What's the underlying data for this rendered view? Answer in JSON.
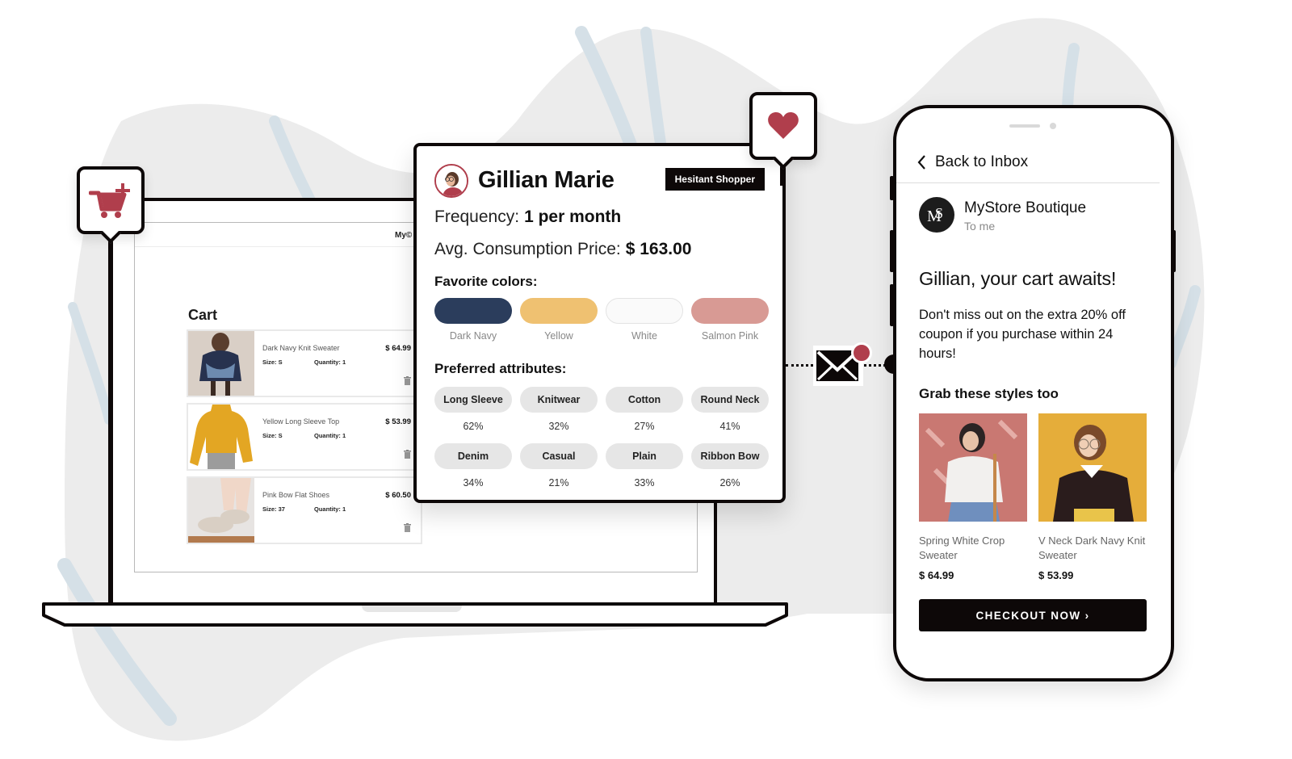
{
  "colors": {
    "accent": "#b03e4c",
    "ink": "#0d0808",
    "background_blob": "#ececec",
    "background_stroke": "#d5e0e7"
  },
  "laptop": {
    "logo_text": "My©",
    "cart": {
      "title": "Cart",
      "items": [
        {
          "name": "Dark Navy Knit Sweater",
          "size": "Size: S",
          "quantity": "Quantity: 1",
          "price": "$ 64.99",
          "image": "navy-sweater-photo"
        },
        {
          "name": "Yellow Long Sleeve Top",
          "size": "Size: S",
          "quantity": "Quantity: 1",
          "price": "$ 53.99",
          "image": "yellow-top-photo"
        },
        {
          "name": "Pink Bow Flat Shoes",
          "size": "Size: 37",
          "quantity": "Quantity: 1",
          "price": "$ 60.50",
          "image": "pink-shoes-photo"
        }
      ],
      "trash_icon": "trash-icon"
    }
  },
  "pins": {
    "cart": {
      "icon": "cart-plus-icon"
    },
    "favorite": {
      "icon": "heart-icon"
    }
  },
  "profile": {
    "name": "Gillian Marie",
    "badge": "Hesitant Shopper",
    "frequency_label": "Frequency:",
    "frequency_value": "1 per month",
    "avg_price_label": "Avg. Consumption Price:",
    "avg_price_value": "$ 163.00",
    "favorite_colors_title": "Favorite colors:",
    "favorite_colors": [
      {
        "label": "Dark Navy",
        "hex": "#2b3d5c"
      },
      {
        "label": "Yellow",
        "hex": "#efc171"
      },
      {
        "label": "White",
        "hex": "#fafafa"
      },
      {
        "label": "Salmon Pink",
        "hex": "#d89a94"
      }
    ],
    "attributes_title": "Preferred attributes:",
    "attributes": [
      {
        "label": "Long Sleeve",
        "percent": "62%"
      },
      {
        "label": "Knitwear",
        "percent": "32%"
      },
      {
        "label": "Cotton",
        "percent": "27%"
      },
      {
        "label": "Round Neck",
        "percent": "41%"
      },
      {
        "label": "Denim",
        "percent": "34%"
      },
      {
        "label": "Casual",
        "percent": "21%"
      },
      {
        "label": "Plain",
        "percent": "33%"
      },
      {
        "label": "Ribbon Bow",
        "percent": "26%"
      }
    ]
  },
  "connector": {
    "icon": "envelope-icon",
    "notification": true
  },
  "phone": {
    "back_label": "Back to Inbox",
    "sender_name": "MyStore Boutique",
    "sender_to": "To me",
    "headline": "Gillian, your cart awaits!",
    "body": "Don't miss out on the extra 20% off coupon if you purchase within 24 hours!",
    "recommendations_title": "Grab these styles too",
    "recommendations": [
      {
        "name": "Spring White Crop Sweater",
        "price": "$ 64.99",
        "image": "white-crop-sweater-photo"
      },
      {
        "name": "V Neck Dark Navy Knit Sweater",
        "price": "$ 53.99",
        "image": "navy-knit-sweater-photo"
      }
    ],
    "checkout_label": "CHECKOUT NOW ›"
  }
}
